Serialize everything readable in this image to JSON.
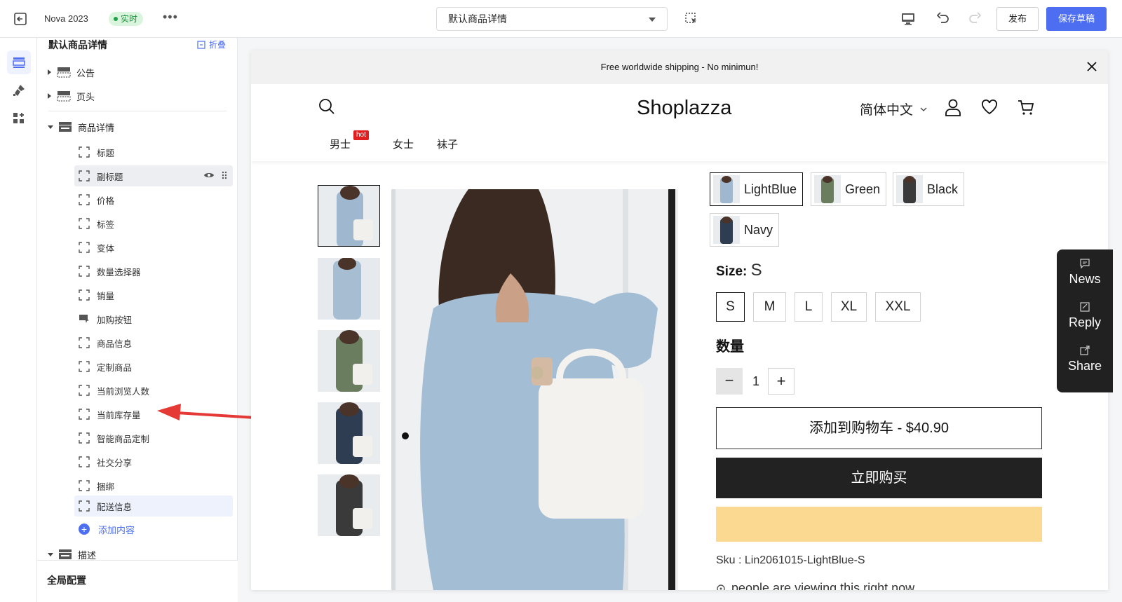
{
  "topbar": {
    "theme_name": "Nova 2023",
    "live_badge": "实时",
    "more": "•••",
    "template_select": "默认商品详情",
    "publish_label": "发布",
    "save_label": "保存草稿"
  },
  "sidebar": {
    "title": "默认商品详情",
    "collapse_label": "折叠",
    "sections": [
      {
        "label": "公告",
        "expanded": false
      },
      {
        "label": "页头",
        "expanded": false
      },
      {
        "label": "商品详情",
        "expanded": true
      },
      {
        "label": "描述",
        "expanded": true
      }
    ],
    "items": [
      {
        "label": "标题"
      },
      {
        "label": "副标题"
      },
      {
        "label": "价格"
      },
      {
        "label": "标签"
      },
      {
        "label": "变体"
      },
      {
        "label": "数量选择器"
      },
      {
        "label": "销量"
      },
      {
        "label": "加购按钮"
      },
      {
        "label": "商品信息"
      },
      {
        "label": "定制商品"
      },
      {
        "label": "当前浏览人数"
      },
      {
        "label": "当前库存量"
      },
      {
        "label": "智能商品定制"
      },
      {
        "label": "社交分享"
      },
      {
        "label": "捆绑"
      },
      {
        "label": "配送信息"
      }
    ],
    "add_content_label": "添加内容",
    "global_config_label": "全局配置"
  },
  "preview": {
    "announcement": "Free worldwide shipping - No minimun!",
    "logo": "Shoplazza",
    "language": "简体中文",
    "nav": [
      {
        "label": "男士",
        "badge": "hot"
      },
      {
        "label": "女士"
      },
      {
        "label": "袜子"
      }
    ],
    "colors": [
      {
        "label": "LightBlue",
        "swatch": "#9fb8cf",
        "selected": true
      },
      {
        "label": "Green",
        "swatch": "#6a7d5f",
        "selected": false
      },
      {
        "label": "Black",
        "swatch": "#3a3a3a",
        "selected": false
      },
      {
        "label": "Navy",
        "swatch": "#2f3d52",
        "selected": false
      }
    ],
    "size_label": "Size:",
    "size_value": "S",
    "sizes": [
      {
        "label": "S",
        "selected": true
      },
      {
        "label": "M",
        "selected": false
      },
      {
        "label": "L",
        "selected": false
      },
      {
        "label": "XL",
        "selected": false
      },
      {
        "label": "XXL",
        "selected": false
      }
    ],
    "quantity_label": "数量",
    "quantity_minus": "−",
    "quantity_value": "1",
    "quantity_plus": "+",
    "add_to_cart_label": "添加到购物车 - $40.90",
    "buy_now_label": "立即购买",
    "sku_text": "Sku : Lin2061015-LightBlue-S",
    "viewing_text": "people are viewing this right now"
  },
  "widget": {
    "items": [
      {
        "label": "News",
        "icon": "message-icon"
      },
      {
        "label": "Reply",
        "icon": "edit-icon"
      },
      {
        "label": "Share",
        "icon": "share-icon"
      }
    ]
  },
  "colors": {
    "accent": "#4e6ef2",
    "live_bg": "#d9f5dd",
    "annotation_red": "#e53935",
    "buy_button": "#222222",
    "pay_button": "#fbd990"
  }
}
